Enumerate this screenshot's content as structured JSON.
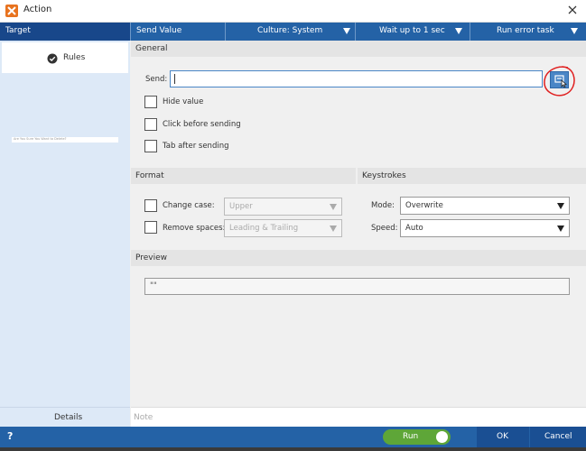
{
  "window": {
    "title": "Action"
  },
  "toolbar": {
    "target": "Target",
    "send_value": "Send Value",
    "culture": "Culture: System",
    "wait": "Wait up to 1 sec",
    "error": "Run error task"
  },
  "sidebar": {
    "rules_label": "Rules",
    "details_label": "Details",
    "thumbnail_text": "Are You Sure You Want to Delete?"
  },
  "general": {
    "heading": "General",
    "send_label": "Send:",
    "send_value": "",
    "hide_value_label": "Hide value",
    "click_before_label": "Click before sending",
    "tab_after_label": "Tab after sending"
  },
  "format": {
    "heading": "Format",
    "change_case_label": "Change case:",
    "change_case_value": "Upper",
    "remove_spaces_label": "Remove spaces:",
    "remove_spaces_value": "Leading & Trailing"
  },
  "keystrokes": {
    "heading": "Keystrokes",
    "mode_label": "Mode:",
    "mode_value": "Overwrite",
    "speed_label": "Speed:",
    "speed_value": "Auto"
  },
  "preview": {
    "heading": "Preview",
    "value": "\"\""
  },
  "note": {
    "placeholder": "Note"
  },
  "bottombar": {
    "help": "?",
    "run_label": "Run",
    "ok_label": "OK",
    "cancel_label": "Cancel"
  },
  "colors": {
    "accent": "#2462a6",
    "accent_dark": "#18478a",
    "run_green": "#5ea638",
    "annotation_red": "#e02020"
  }
}
